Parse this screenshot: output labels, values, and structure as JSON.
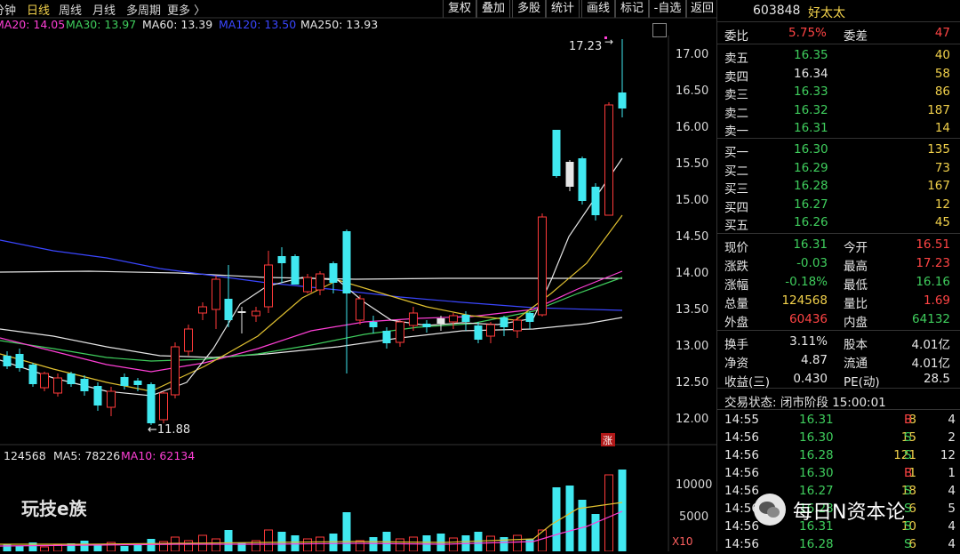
{
  "toolbar": {
    "tabs": [
      "分钟",
      "日线",
      "周线",
      "月线",
      "多周期",
      "更多 〉"
    ],
    "active_tab": "日线",
    "buttons": [
      "复权",
      "叠加",
      "多股",
      "统计",
      "画线",
      "标记",
      "-自选",
      "返回"
    ]
  },
  "ma_legend": [
    {
      "text": "MA20: 14.05",
      "color": "#ff3fd6"
    },
    {
      "text": "MA30: 13.97",
      "color": "#3fce5d"
    },
    {
      "text": "MA60: 13.39",
      "color": "#e6e6e6"
    },
    {
      "text": "MA120: 13.50",
      "color": "#3a46ff"
    },
    {
      "text": "MA250: 13.93",
      "color": "#e6e6e6"
    }
  ],
  "price_axis": [
    "17.00",
    "16.50",
    "16.00",
    "15.50",
    "15.00",
    "14.50",
    "14.00",
    "13.50",
    "13.00",
    "12.50",
    "12.00"
  ],
  "annotations": {
    "high_label": "17.23",
    "low_label": "←11.88",
    "zhang_badge": "涨"
  },
  "volume_legend": [
    {
      "text": "124568",
      "color": "#e6e6e6"
    },
    {
      "text": "MA5: 78226",
      "color": "#e6e6e6"
    },
    {
      "text": "MA10: 62134",
      "color": "#ff3fd6"
    }
  ],
  "volume_axis": [
    "10000",
    "5000",
    "X10"
  ],
  "watermarks": {
    "left": "玩技e族",
    "right": "每日N资本论"
  },
  "stock": {
    "code": "603848",
    "name": "好太太"
  },
  "order_summary": {
    "wb_label": "委比",
    "wb_value": "5.75%",
    "wc_label": "委差",
    "wc_value": "47"
  },
  "asks": [
    {
      "label": "卖五",
      "price": "16.35",
      "vol": "40"
    },
    {
      "label": "卖四",
      "price": "16.34",
      "vol": "58"
    },
    {
      "label": "卖三",
      "price": "16.33",
      "vol": "86"
    },
    {
      "label": "卖二",
      "price": "16.32",
      "vol": "187"
    },
    {
      "label": "卖一",
      "price": "16.31",
      "vol": "14"
    }
  ],
  "bids": [
    {
      "label": "买一",
      "price": "16.30",
      "vol": "135"
    },
    {
      "label": "买二",
      "price": "16.29",
      "vol": "73"
    },
    {
      "label": "买三",
      "price": "16.28",
      "vol": "167"
    },
    {
      "label": "买四",
      "price": "16.27",
      "vol": "12"
    },
    {
      "label": "买五",
      "price": "16.26",
      "vol": "45"
    }
  ],
  "quote": [
    {
      "l1": "现价",
      "v1": "16.31",
      "c1": "g",
      "l2": "今开",
      "v2": "16.51",
      "c2": "r"
    },
    {
      "l1": "涨跌",
      "v1": "-0.03",
      "c1": "g",
      "l2": "最高",
      "v2": "17.23",
      "c2": "r"
    },
    {
      "l1": "涨幅",
      "v1": "-0.18%",
      "c1": "g",
      "l2": "最低",
      "v2": "16.16",
      "c2": "g"
    },
    {
      "l1": "总量",
      "v1": "124568",
      "c1": "y",
      "l2": "量比",
      "v2": "1.69",
      "c2": "r"
    },
    {
      "l1": "外盘",
      "v1": "60436",
      "c1": "r",
      "l2": "内盘",
      "v2": "64132",
      "c2": "g"
    }
  ],
  "stats": [
    {
      "l1": "换手",
      "v1": "3.11%",
      "l2": "股本",
      "v2": "4.01亿"
    },
    {
      "l1": "净资",
      "v1": "4.87",
      "l2": "流通",
      "v2": "4.01亿"
    },
    {
      "l1": "收益(三)",
      "v1": "0.430",
      "l2": "PE(动)",
      "v2": "28.5"
    }
  ],
  "trade_status": "交易状态: 闭市阶段 15:00:01",
  "ticks": [
    {
      "time": "14:55",
      "price": "16.31",
      "vol": "8",
      "side": "B",
      "num": "4"
    },
    {
      "time": "14:56",
      "price": "16.30",
      "vol": "15",
      "side": "S",
      "num": "2"
    },
    {
      "time": "14:56",
      "price": "16.28",
      "vol": "121",
      "side": "S",
      "num": "12"
    },
    {
      "time": "14:56",
      "price": "16.30",
      "vol": "1",
      "side": "B",
      "num": "1"
    },
    {
      "time": "14:56",
      "price": "16.27",
      "vol": "18",
      "side": "S",
      "num": "4"
    },
    {
      "time": "14:56",
      "price": "16.28",
      "vol": "6",
      "side": "S",
      "num": "5"
    },
    {
      "time": "14:56",
      "price": "16.31",
      "vol": "10",
      "side": "S",
      "num": "4"
    },
    {
      "time": "14:56",
      "price": "16.28",
      "vol": "6",
      "side": "S",
      "num": "4"
    }
  ]
}
